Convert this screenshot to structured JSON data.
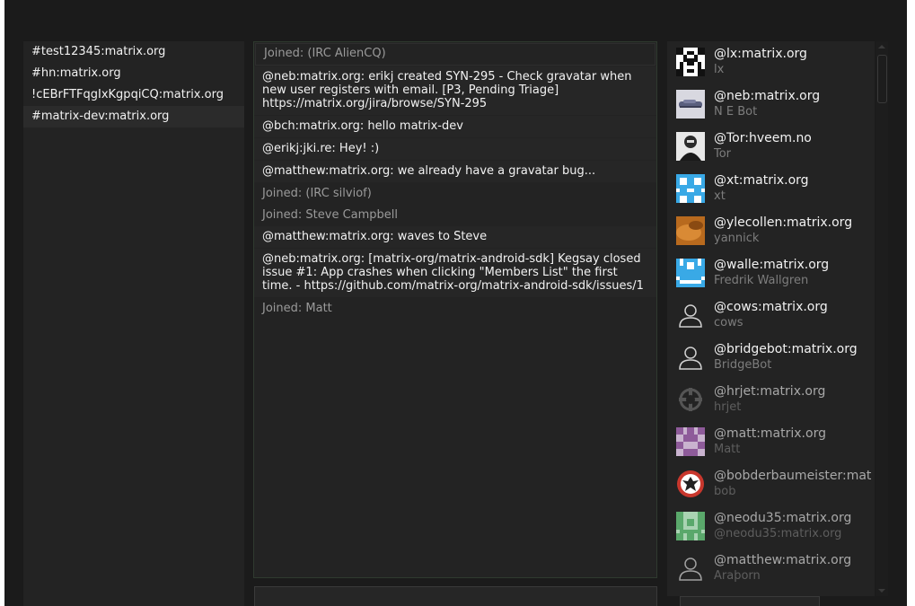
{
  "rooms": [
    {
      "label": "#test12345:matrix.org",
      "active": false
    },
    {
      "label": "#hn:matrix.org",
      "active": false
    },
    {
      "label": "!cEBrFTFqgIxKgpqiCQ:matrix.org",
      "active": false
    },
    {
      "label": "#matrix-dev:matrix.org",
      "active": true
    }
  ],
  "timeline": [
    {
      "type": "notice",
      "text": "Joined: (IRC AlienCQ)"
    },
    {
      "type": "msg",
      "text": "@neb:matrix.org: erikj created SYN-295 - Check gravatar when new user registers with email. [P3, Pending Triage] https://matrix.org/jira/browse/SYN-295"
    },
    {
      "type": "msg",
      "text": "@bch:matrix.org: hello matrix-dev"
    },
    {
      "type": "msg",
      "text": "@erikj:jki.re: Hey! :)"
    },
    {
      "type": "msg",
      "text": "@matthew:matrix.org: we already have a gravatar bug..."
    },
    {
      "type": "notice",
      "text": "Joined: (IRC silviof)"
    },
    {
      "type": "notice",
      "text": "Joined: Steve Campbell"
    },
    {
      "type": "msg",
      "text": "@matthew:matrix.org: waves to Steve"
    },
    {
      "type": "msg",
      "text": "@neb:matrix.org: [matrix-org/matrix-android-sdk] Kegsay closed issue #1: App crashes when clicking \"Members List\" the first time. - https://github.com/matrix-org/matrix-android-sdk/issues/1"
    },
    {
      "type": "notice",
      "text": "Joined: Matt"
    }
  ],
  "members": [
    {
      "name": "@lx:matrix.org",
      "display": "lx",
      "avatar": "identicon-checker",
      "faded": false
    },
    {
      "name": "@neb:matrix.org",
      "display": "N E Bot",
      "avatar": "robot-photo",
      "faded": false
    },
    {
      "name": "@Tor:hveem.no",
      "display": "Tor",
      "avatar": "person-photo",
      "faded": false
    },
    {
      "name": "@xt:matrix.org",
      "display": "xt",
      "avatar": "identicon-blue",
      "faded": false
    },
    {
      "name": "@ylecollen:matrix.org",
      "display": "yannick",
      "avatar": "orange-photo",
      "faded": false
    },
    {
      "name": "@walle:matrix.org",
      "display": "Fredrik Wallgren",
      "avatar": "identicon-blue-face",
      "faded": false
    },
    {
      "name": "@cows:matrix.org",
      "display": "cows",
      "avatar": "default-user-icon",
      "faded": false
    },
    {
      "name": "@bridgebot:matrix.org",
      "display": "BridgeBot",
      "avatar": "default-user-icon",
      "faded": false
    },
    {
      "name": "@hrjet:matrix.org",
      "display": "hrjet",
      "avatar": "gear-shape-icon",
      "faded": true
    },
    {
      "name": "@matt:matrix.org",
      "display": "Matt",
      "avatar": "identicon-purple",
      "faded": true
    },
    {
      "name": "@bobderbaumeister:mat",
      "display": "bob",
      "avatar": "eagle-crest-icon",
      "faded": true
    },
    {
      "name": "@neodu35:matrix.org",
      "display": "@neodu35:matrix.org",
      "avatar": "identicon-green",
      "faded": true
    },
    {
      "name": "@matthew:matrix.org",
      "display": "Araþorn",
      "avatar": "default-user-icon",
      "faded": true
    }
  ],
  "colors": {
    "background": "#1b1b1b",
    "panel": "#232323",
    "text": "#f2f2f2",
    "muted": "#9a9a9a",
    "identicon_blue": "#39a9e6",
    "identicon_purple": "#8e5b9a",
    "identicon_green": "#5aa86b",
    "crest_red": "#c8372d"
  }
}
